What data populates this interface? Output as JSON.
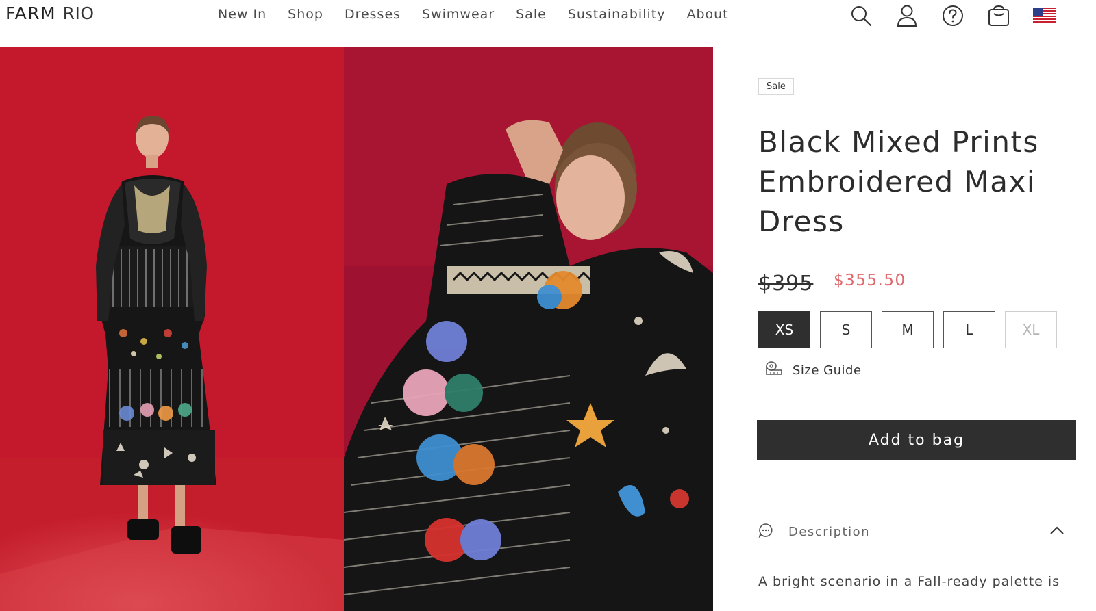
{
  "brand": {
    "logo_part1": "FARM",
    "logo_part2": "RIO"
  },
  "nav": {
    "items": [
      "New In",
      "Shop",
      "Dresses",
      "Swimwear",
      "Sale",
      "Sustainability",
      "About"
    ]
  },
  "header_icons": [
    "search-icon",
    "account-icon",
    "help-icon",
    "bag-icon",
    "us-flag-icon"
  ],
  "product": {
    "badge": "Sale",
    "title": "Black Mixed Prints Embroidered Maxi Dress",
    "price_original": "$395",
    "price_sale": "$355.50",
    "sizes": [
      {
        "label": "XS",
        "selected": true,
        "available": true
      },
      {
        "label": "S",
        "selected": false,
        "available": true
      },
      {
        "label": "M",
        "selected": false,
        "available": true
      },
      {
        "label": "L",
        "selected": false,
        "available": true
      },
      {
        "label": "XL",
        "selected": false,
        "available": false
      }
    ],
    "size_guide_label": "Size Guide",
    "add_to_bag_label": "Add to bag",
    "description_label": "Description",
    "description_text": "A bright scenario in a Fall-ready palette is"
  },
  "colors": {
    "backdrop_left": "#c41d2c",
    "backdrop_right": "#a3132d",
    "sale_price": "#e0676a",
    "button_dark": "#2f2f2f"
  }
}
